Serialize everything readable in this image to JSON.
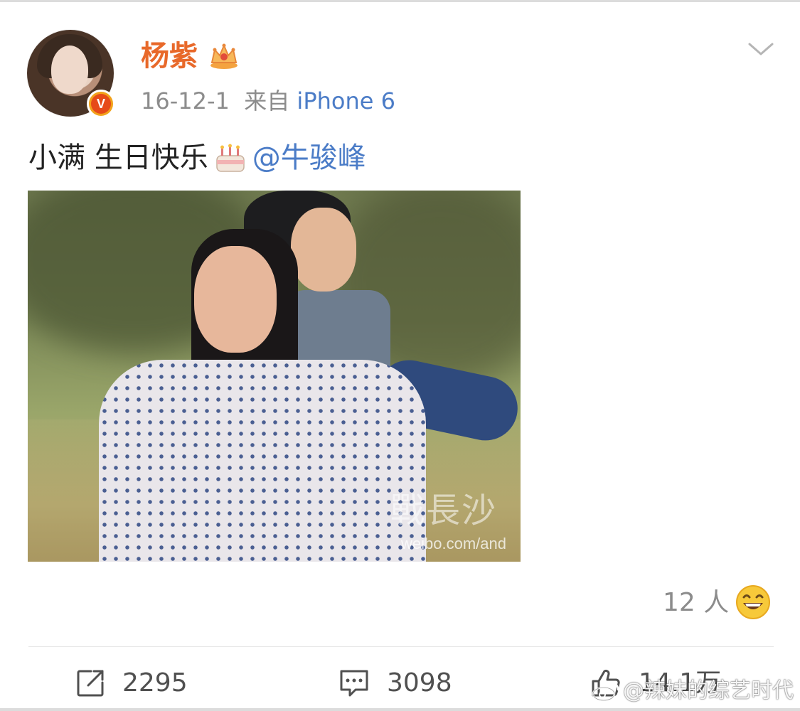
{
  "post": {
    "author": "杨紫",
    "verified_badge": "V",
    "date": "16-12-1",
    "source_prefix": "来自",
    "device": "iPhone 6",
    "text_main": "小满 生日快乐",
    "mention": "@牛骏峰",
    "image_watermark_text": "戰長沙",
    "image_watermark_url": "weibo.com/and",
    "reaction_count": "12 人",
    "reposts": "2295",
    "comments": "3098",
    "likes": "14.1万"
  },
  "watermark": {
    "text": "@辣妹的综艺时代"
  },
  "colors": {
    "username": "#e8692a",
    "link": "#4b7cc7",
    "meta": "#8c8c8c"
  },
  "icons": {
    "crown": "crown-icon",
    "chevron": "chevron-down-icon",
    "cake": "cake-icon",
    "laugh": "laugh-emoji-icon",
    "repost": "repost-icon",
    "comment": "comment-icon",
    "like": "thumbs-up-icon"
  }
}
